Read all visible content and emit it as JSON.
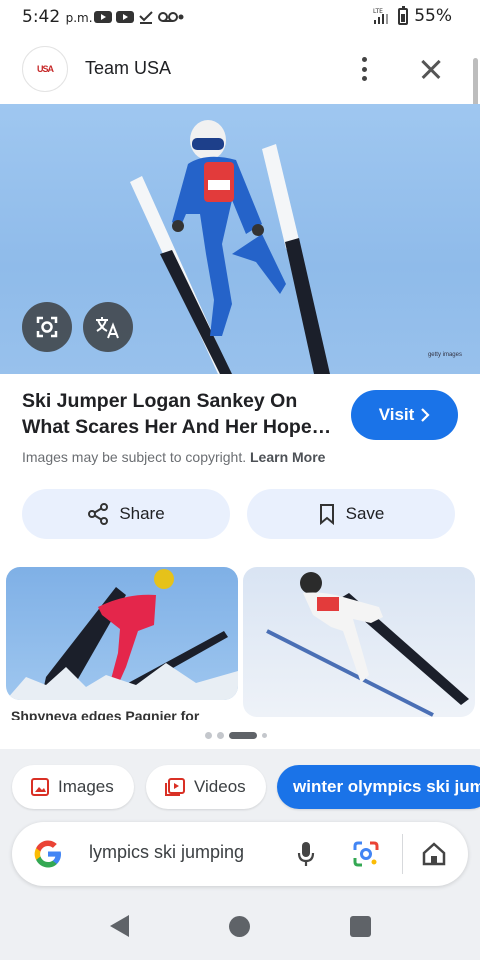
{
  "status_bar": {
    "time": "5:42",
    "time_suffix": "p.m.",
    "network": "LTE",
    "battery": "55%"
  },
  "header": {
    "site_name": "Team USA",
    "favicon_text": "USA"
  },
  "hero": {
    "watermark": "getty images"
  },
  "result": {
    "title": "Ski Jumper Logan Sankey On What Scares Her And Her Hope…",
    "visit_label": "Visit",
    "copyright_text": "Images may be subject to copyright.",
    "learn_more": "Learn More"
  },
  "actions": {
    "share_label": "Share",
    "save_label": "Save"
  },
  "related": {
    "items": [
      {
        "caption": "Shpyneva edges Pagnier for"
      },
      {
        "caption": ""
      }
    ],
    "pages": 4,
    "active_page": 3
  },
  "chips": {
    "images_label": "Images",
    "videos_label": "Videos",
    "query_label": "winter olympics ski jum"
  },
  "search": {
    "query_text": "lympics ski jumping"
  },
  "colors": {
    "accent": "#1a73e8",
    "pill_bg": "#e9f0fd",
    "sheet_bg": "#eef0f3"
  },
  "icons": [
    "camera-lens-icon",
    "translate-icon",
    "share-icon",
    "bookmark-icon",
    "chevron-right-icon",
    "images-icon",
    "videos-icon",
    "google-logo-icon",
    "mic-icon",
    "lens-icon",
    "home-icon",
    "close-icon",
    "kebab-menu-icon"
  ]
}
